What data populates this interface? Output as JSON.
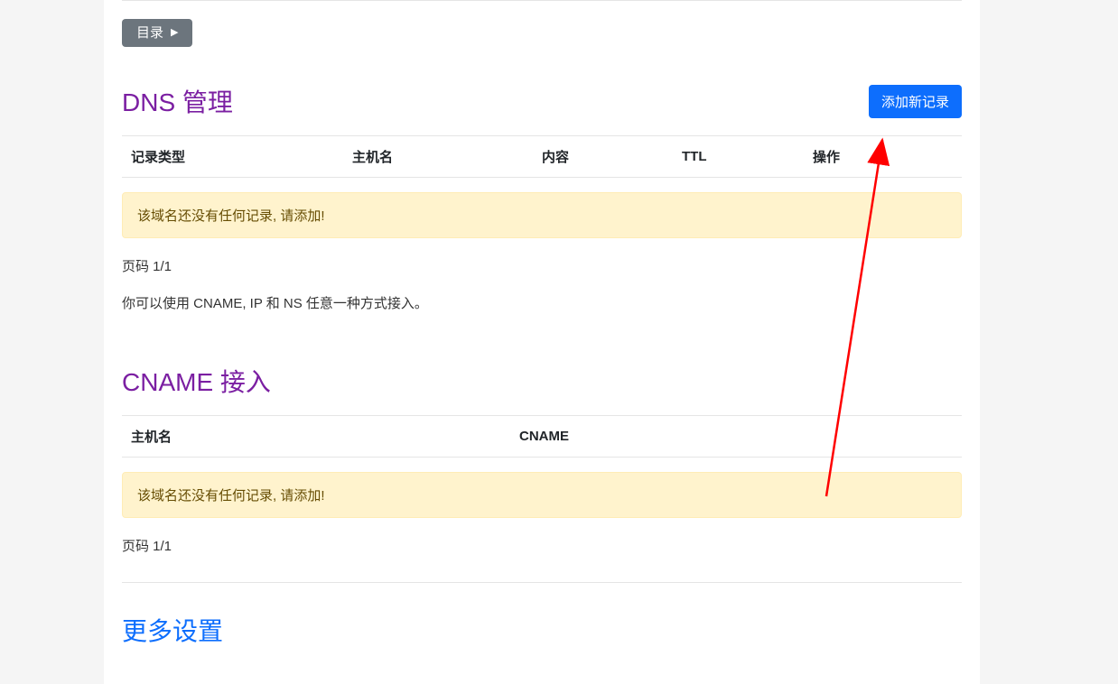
{
  "toc": {
    "label": "目录"
  },
  "dns": {
    "title": "DNS 管理",
    "add_button": "添加新记录",
    "columns": {
      "type": "记录类型",
      "host": "主机名",
      "content": "内容",
      "ttl": "TTL",
      "action": "操作"
    },
    "empty_alert": "该域名还没有任何记录, 请添加!",
    "pagination": "页码 1/1",
    "help_text": "你可以使用 CNAME, IP 和 NS 任意一种方式接入。"
  },
  "cname": {
    "title": "CNAME 接入",
    "columns": {
      "host": "主机名",
      "cname": "CNAME"
    },
    "empty_alert": "该域名还没有任何记录, 请添加!",
    "pagination": "页码 1/1"
  },
  "more": {
    "title": "更多设置"
  }
}
